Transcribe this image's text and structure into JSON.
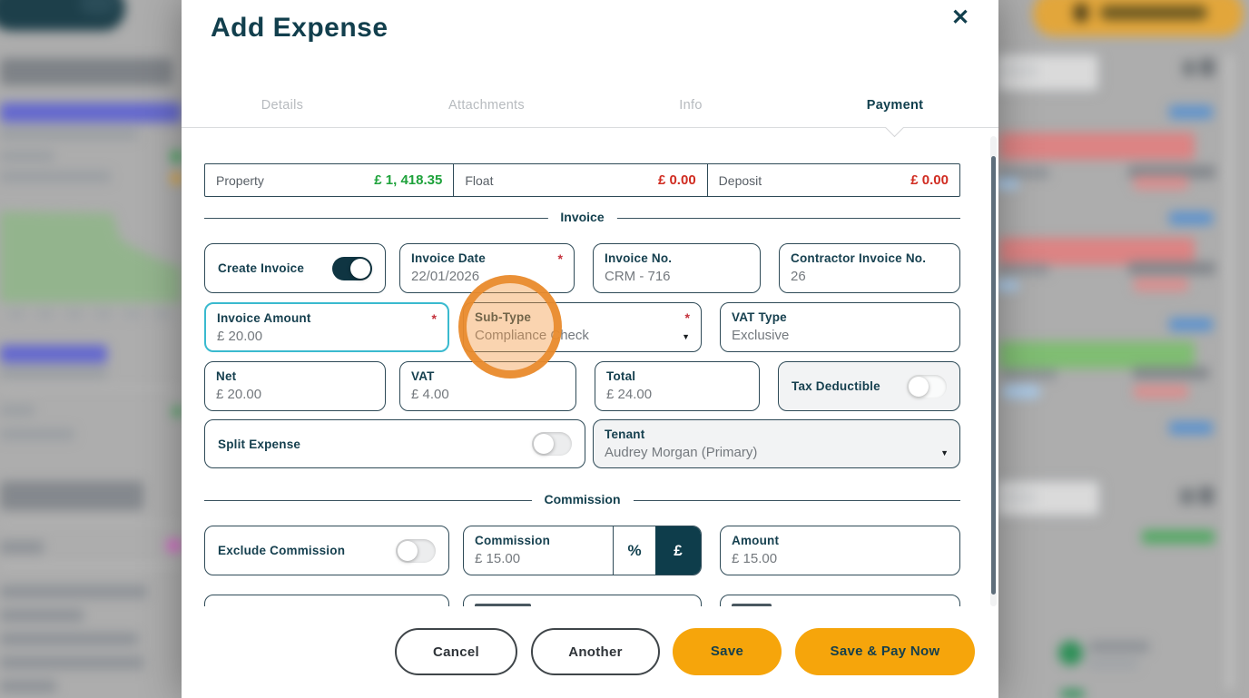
{
  "modal": {
    "title": "Add Expense",
    "close_icon": "✕",
    "tabs": [
      {
        "label": "Details"
      },
      {
        "label": "Attachments"
      },
      {
        "label": "Info"
      },
      {
        "label": "Payment"
      }
    ],
    "summary": {
      "property": {
        "label": "Property",
        "value": "£ 1, 418.35"
      },
      "float": {
        "label": "Float",
        "value": "£ 0.00"
      },
      "deposit": {
        "label": "Deposit",
        "value": "£ 0.00"
      }
    },
    "sections": {
      "invoice": "Invoice",
      "commission": "Commission"
    },
    "fields": {
      "create_invoice": {
        "label": "Create Invoice",
        "state": "on"
      },
      "invoice_date": {
        "label": "Invoice Date",
        "value": "22/01/2026",
        "required": "*"
      },
      "invoice_no": {
        "label": "Invoice No.",
        "value": "CRM - 716"
      },
      "contractor_invoice_no": {
        "label": "Contractor Invoice No.",
        "value": "26"
      },
      "invoice_amount": {
        "label": "Invoice Amount",
        "value": "£ 20.00",
        "required": "*"
      },
      "sub_type": {
        "label": "Sub-Type",
        "value": "Compliance Check",
        "required": "*",
        "caret": "▼"
      },
      "vat_type": {
        "label": "VAT Type",
        "value": "Exclusive"
      },
      "net": {
        "label": "Net",
        "value": "£ 20.00"
      },
      "vat": {
        "label": "VAT",
        "value": "£ 4.00"
      },
      "total": {
        "label": "Total",
        "value": "£ 24.00"
      },
      "tax_deductible": {
        "label": "Tax Deductible",
        "state": "off"
      },
      "split_expense": {
        "label": "Split Expense",
        "state": "off"
      },
      "tenant": {
        "label": "Tenant",
        "value": "Audrey Morgan (Primary)",
        "caret": "▼"
      },
      "exclude_commission": {
        "label": "Exclude Commission",
        "state": "off"
      },
      "commission": {
        "label": "Commission",
        "value": "£ 15.00",
        "unit_percent": "%",
        "unit_pound": "£",
        "selected_unit": "£"
      },
      "amount": {
        "label": "Amount",
        "value": "£ 15.00"
      }
    },
    "footer": {
      "cancel": "Cancel",
      "another": "Another",
      "save": "Save",
      "save_pay_now": "Save & Pay Now"
    }
  },
  "colors": {
    "accent_orange": "#F6A50B",
    "teal_dark": "#123F4D",
    "positive_green": "#1EA23B",
    "negative_red": "#D02B20",
    "focus_cyan": "#3ABACF",
    "highlight_ring": "#E88A2B"
  }
}
